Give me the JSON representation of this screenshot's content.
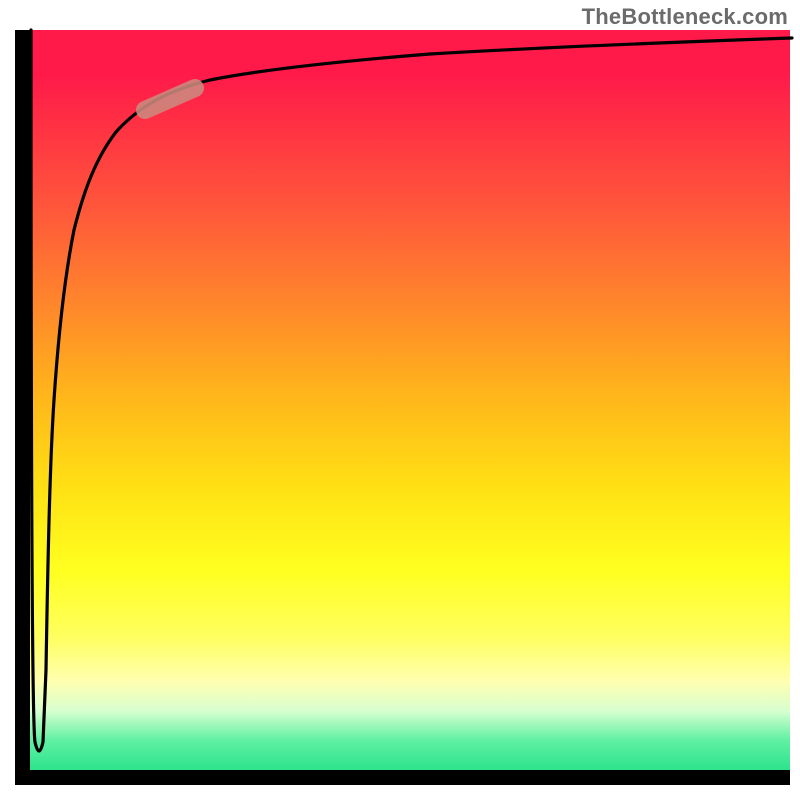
{
  "watermark": {
    "text": "TheBottleneck.com"
  },
  "colors": {
    "axis": "#000000",
    "curve": "#000000",
    "marker": "#cc8a7e",
    "gradient_top": "#ff1a4a",
    "gradient_bottom": "#2de38c"
  },
  "chart_data": {
    "type": "line",
    "title": "",
    "xlabel": "",
    "ylabel": "",
    "xlim": [
      0,
      100
    ],
    "ylim": [
      0,
      100
    ],
    "grid": false,
    "legend": false,
    "series": [
      {
        "name": "bottleneck-curve",
        "x": [
          0,
          0.25,
          0.5,
          0.75,
          1,
          1.5,
          2,
          3,
          4,
          5,
          7,
          10,
          15,
          20,
          30,
          40,
          50,
          60,
          70,
          80,
          90,
          100
        ],
        "y": [
          100,
          50,
          20,
          5,
          5,
          30,
          52,
          70,
          78,
          82,
          86,
          89,
          91.5,
          93,
          94.5,
          95.5,
          96.2,
          96.8,
          97.2,
          97.6,
          98,
          98.3
        ]
      }
    ],
    "annotations": [
      {
        "name": "marker-pill",
        "x_start": 15,
        "y_start": 91.5,
        "x_end": 21,
        "y_end": 93,
        "color": "#cc8a7e"
      }
    ]
  }
}
